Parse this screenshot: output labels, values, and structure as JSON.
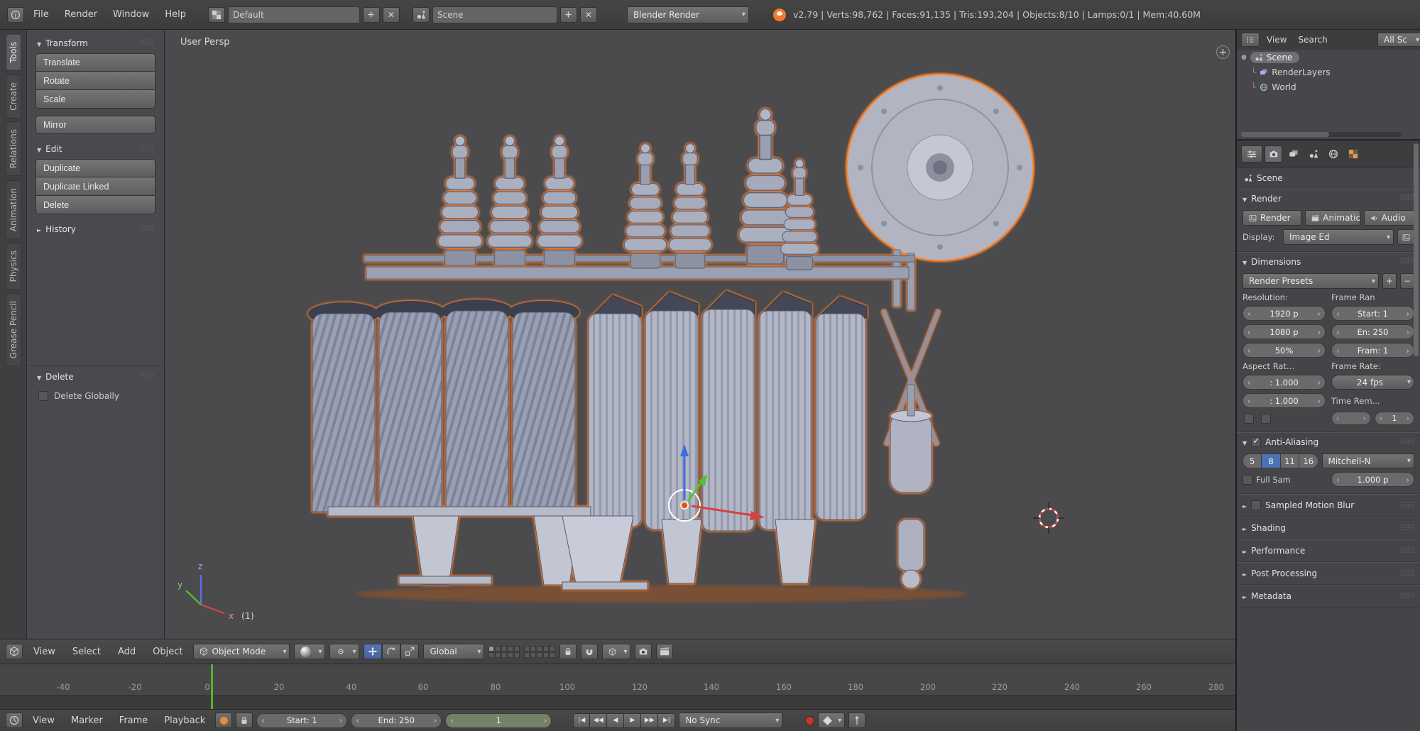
{
  "topbar": {
    "menus": [
      "File",
      "Render",
      "Window",
      "Help"
    ],
    "layout_value": "Default",
    "scene_value": "Scene",
    "engine_value": "Blender Render",
    "stats": "v2.79 | Verts:98,762 | Faces:91,135 | Tris:193,204 | Objects:8/10 | Lamps:0/1 | Mem:40.60M"
  },
  "tool_tabs": [
    "Tools",
    "Create",
    "Relations",
    "Animation",
    "Physics",
    "Grease Pencil"
  ],
  "toolshelf": {
    "transform_title": "Transform",
    "translate": "Translate",
    "rotate": "Rotate",
    "scale": "Scale",
    "mirror": "Mirror",
    "edit_title": "Edit",
    "duplicate": "Duplicate",
    "duplicate_linked": "Duplicate Linked",
    "delete": "Delete",
    "history_title": "History",
    "delete_panel_title": "Delete",
    "delete_globally": "Delete Globally"
  },
  "viewport": {
    "view_label": "User Persp",
    "object_count": "(1)",
    "axis_x": "x",
    "axis_y": "y",
    "axis_z": "z",
    "plus": "+"
  },
  "outliner": {
    "view": "View",
    "search": "Search",
    "filter": "All Sc",
    "scene": "Scene",
    "renderlayers": "RenderLayers",
    "world": "World"
  },
  "properties": {
    "context": "Scene",
    "render_title": "Render",
    "btn_render": "Render",
    "btn_animation": "Animation",
    "btn_audio": "Audio",
    "display_label": "Display:",
    "display_value": "Image Ed",
    "dims_title": "Dimensions",
    "presets": "Render Presets",
    "resolution_label": "Resolution:",
    "frame_range_label": "Frame Ran",
    "res_x": "1920 p",
    "res_y": "1080 p",
    "res_pct": "50%",
    "frame_start": "Start: 1",
    "frame_end": "En: 250",
    "frame_step": "Fram: 1",
    "aspect_label": "Aspect Rat...",
    "framerate_label": "Frame Rate:",
    "aspect_x": ": 1.000",
    "aspect_y": ": 1.000",
    "fps": "24 fps",
    "time_remap_label": "Time Rem...",
    "remap_b": "1",
    "aa_title": "Anti-Aliasing",
    "aa_samples": [
      "5",
      "8",
      "11",
      "16"
    ],
    "aa_filter": "Mitchell-N",
    "full_sample": "Full Sam",
    "filter_size": "1.000 p",
    "collapsed": [
      "Sampled Motion Blur",
      "Shading",
      "Performance",
      "Post Processing",
      "Metadata"
    ]
  },
  "vp_header": {
    "menus": [
      "View",
      "Select",
      "Add",
      "Object"
    ],
    "mode": "Object Mode",
    "orientation": "Global"
  },
  "timeline": {
    "menus": [
      "View",
      "Marker",
      "Frame",
      "Playback"
    ],
    "start_label": "Start:",
    "start_value": "1",
    "end_label": "End:",
    "end_value": "250",
    "frame": "1",
    "sync": "No Sync",
    "transport": [
      "|◀",
      "◀◀",
      "◀",
      "▶",
      "▶▶",
      "▶|"
    ],
    "ticks": [
      "-40",
      "-20",
      "0",
      "20",
      "40",
      "60",
      "80",
      "100",
      "120",
      "140",
      "160",
      "180",
      "200",
      "220",
      "240",
      "260",
      "280"
    ]
  }
}
